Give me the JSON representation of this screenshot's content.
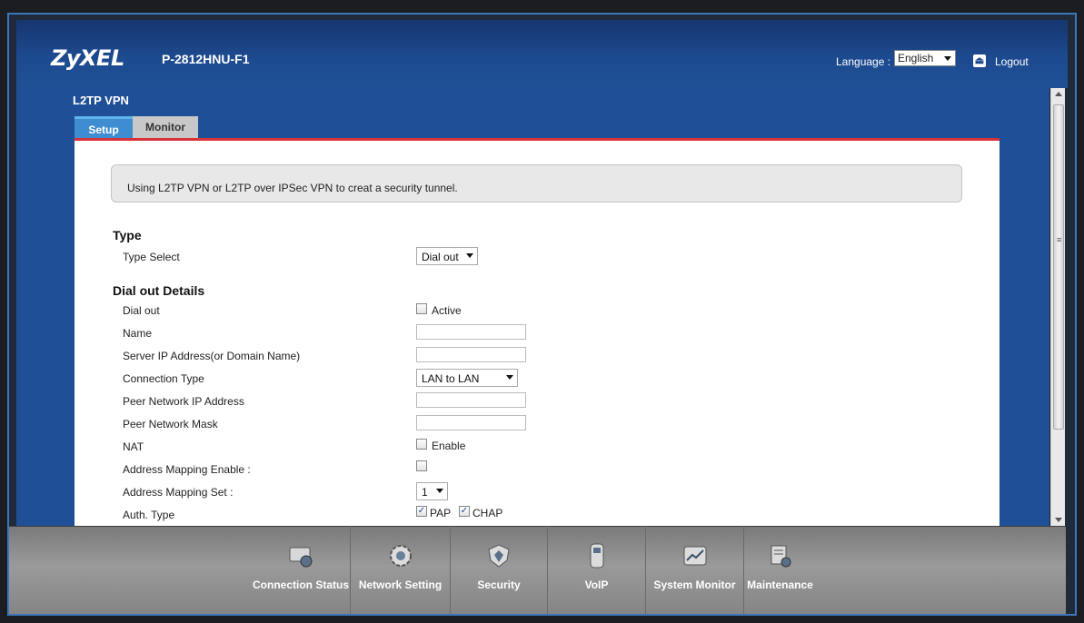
{
  "header": {
    "logo": "ZyXEL",
    "model": "P-2812HNU-F1",
    "language_label": "Language :",
    "language_value": "English",
    "logout_label": "Logout"
  },
  "page": {
    "title": "L2TP VPN",
    "tabs": [
      {
        "label": "Setup",
        "active": true
      },
      {
        "label": "Monitor",
        "active": false
      }
    ],
    "info": "Using L2TP VPN or L2TP over IPSec VPN to creat a security tunnel."
  },
  "form": {
    "type_section": "Type",
    "type_select_label": "Type Select",
    "type_select_value": "Dial out",
    "details_section": "Dial out Details",
    "dial_out_label": "Dial out",
    "active_label": "Active",
    "name_label": "Name",
    "server_label": "Server IP Address(or Domain Name)",
    "connection_type_label": "Connection Type",
    "connection_type_value": "LAN to LAN",
    "peer_ip_label": "Peer Network IP Address",
    "peer_mask_label": "Peer Network Mask",
    "nat_label": "NAT",
    "nat_enable_label": "Enable",
    "addr_map_enable_label": "Address Mapping Enable :",
    "addr_map_set_label": "Address Mapping Set :",
    "addr_map_set_value": "1",
    "auth_type_label": "Auth. Type",
    "pap_label": "PAP",
    "chap_label": "CHAP"
  },
  "bottom_nav": [
    {
      "label": "Connection Status",
      "icon": "connection-status-icon"
    },
    {
      "label": "Network Setting",
      "icon": "gear-icon"
    },
    {
      "label": "Security",
      "icon": "shield-icon"
    },
    {
      "label": "VoIP",
      "icon": "phone-icon"
    },
    {
      "label": "System Monitor",
      "icon": "monitor-chart-icon"
    },
    {
      "label": "Maintenance",
      "icon": "maintenance-icon"
    }
  ],
  "colors": {
    "header_blue": "#1d4a8f",
    "tab_active": "#3d8dd0",
    "accent_red": "#d9333a"
  }
}
